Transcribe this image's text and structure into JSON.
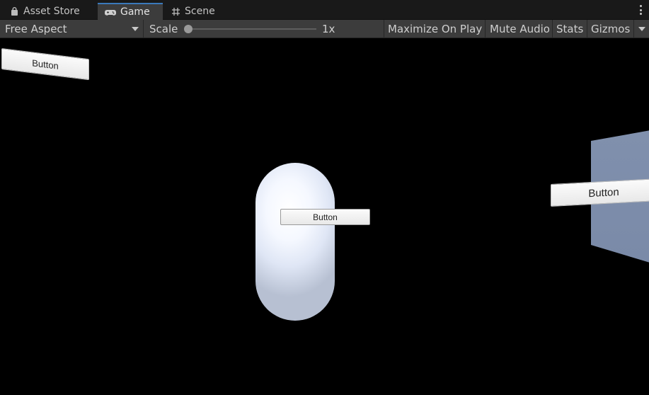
{
  "tabs": [
    {
      "label": "Asset Store",
      "icon": "bag-icon"
    },
    {
      "label": "Game",
      "icon": "gamepad-icon",
      "active": true
    },
    {
      "label": "Scene",
      "icon": "grid-icon"
    }
  ],
  "toolbar": {
    "aspect_value": "Free Aspect",
    "scale_label": "Scale",
    "scale_value": "1x",
    "scale_level": 0.0,
    "maximize_label": "Maximize On Play",
    "mute_label": "Mute Audio",
    "stats_label": "Stats",
    "gizmos_label": "Gizmos"
  },
  "scene": {
    "left_button_label": "Button",
    "center_button_label": "Button",
    "right_button_label": "Button"
  },
  "colors": {
    "accent": "#3a79bb",
    "panel": "#7f8fad",
    "background": "#000000"
  }
}
